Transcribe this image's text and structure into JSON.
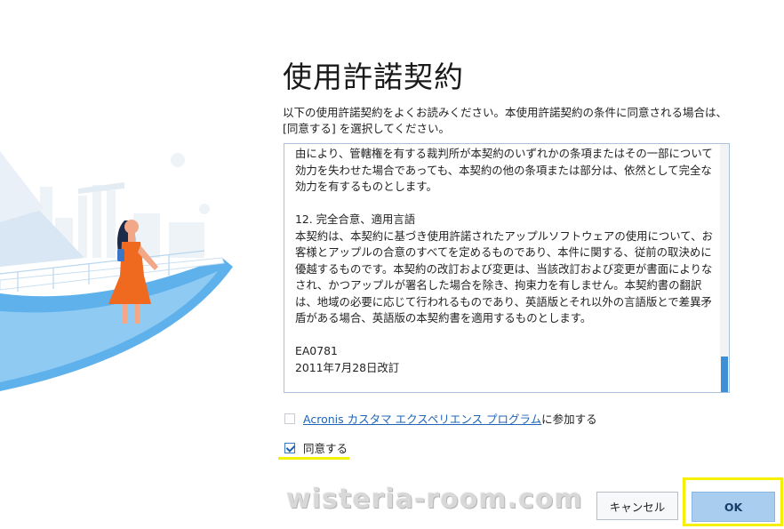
{
  "dialog": {
    "title": "使用許諾契約",
    "intro": "以下の使用許諾契約をよくお読みください。本使用許諾契約の条件に同意される場合は、[同意する] を選択してください。"
  },
  "license": {
    "paragraphs": [
      "由により、管轄権を有する裁判所が本契約のいずれかの条項またはその一部について効力を失わせた場合であっても、本契約の他の条項または部分は、依然として完全な効力を有するものとします。",
      "12. 完全合意、適用言語",
      "本契約は、本契約に基づき使用許諾されたアップルソフトウェアの使用について、お客様とアップルの合意のすべてを定めるものであり、本件に関する、従前の取決めに優越するものです。本契約の改訂および変更は、当該改訂および変更が書面によりなされ、かつアップルが署名した場合を除き、拘束力を有しません。本契約書の翻訳は、地域の必要に応じて行われるものであり、英語版とそれ以外の言語版とで差異矛盾がある場合、英語版の本契約書を適用するものとします。",
      "EA0781",
      "2011年7月28日改訂"
    ]
  },
  "options": {
    "acronis_link": "Acronis カスタマ エクスペリエンス プログラム",
    "acronis_suffix": "に参加する",
    "acronis_checked": false,
    "agree_label": "同意する",
    "agree_checked": true
  },
  "watermark": "wisteria-room.com",
  "buttons": {
    "cancel": "キャンセル",
    "ok": "OK"
  },
  "colors": {
    "accent": "#1f64b7",
    "ok_button": "#a9cdef",
    "highlight": "#f4f000"
  },
  "icons": [
    "checkbox-icon",
    "checkmark-icon"
  ]
}
